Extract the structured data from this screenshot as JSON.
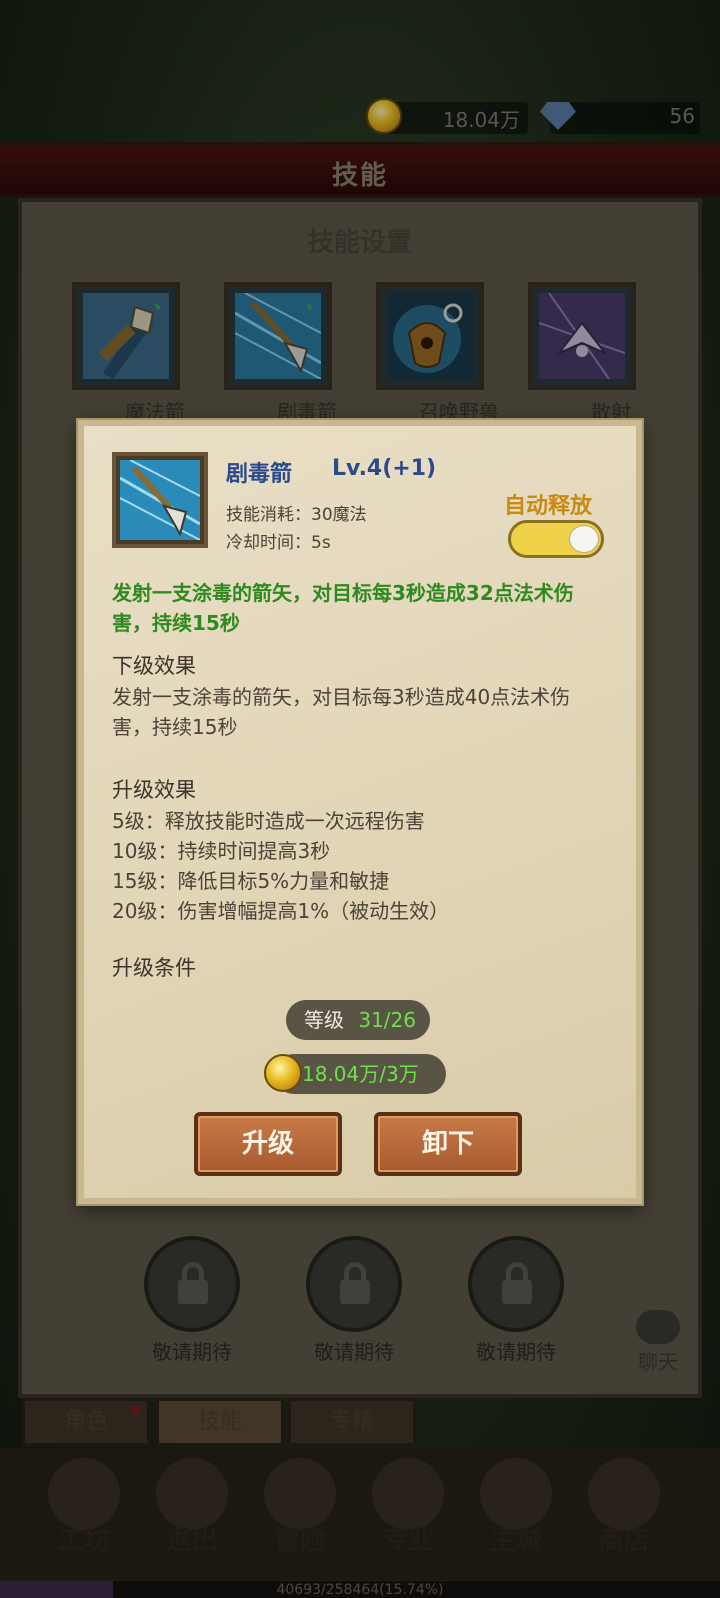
{
  "currency": {
    "gold": "18.04万",
    "gems": "56"
  },
  "window": {
    "title": "技能",
    "settings_title": "技能设置"
  },
  "skill_slots": [
    {
      "name": "魔法箭"
    },
    {
      "name": "剧毒箭"
    },
    {
      "name": "召唤野兽"
    },
    {
      "name": "散射"
    }
  ],
  "locked_slots": [
    {
      "label": "敬请期待"
    },
    {
      "label": "敬请期待"
    },
    {
      "label": "敬请期待"
    }
  ],
  "chat": {
    "label": "聊天"
  },
  "tabs": [
    {
      "label": "角色"
    },
    {
      "label": "技能"
    },
    {
      "label": "专精"
    }
  ],
  "bottom_nav": [
    {
      "label": "工坊"
    },
    {
      "label": "退出"
    },
    {
      "label": "冒险"
    },
    {
      "label": "专业"
    },
    {
      "label": "主城"
    },
    {
      "label": "商店"
    }
  ],
  "exp": {
    "text": "40693/258464(15.74%)",
    "progress": 0.1574
  },
  "popup": {
    "skill_name": "剧毒箭",
    "level": "Lv.4(+1)",
    "cost": "技能消耗：30魔法",
    "cooldown": "冷却时间：5s",
    "auto_label": "自动释放",
    "auto_enabled": true,
    "current_desc": "发射一支涂毒的箭矢，对目标每3秒造成32点法术伤害，持续15秒",
    "next_title": "下级效果",
    "next_desc": "发射一支涂毒的箭矢，对目标每3秒造成40点法术伤害，持续15秒",
    "upgrade_title": "升级效果",
    "upgrade_effects": [
      "5级：释放技能时造成一次远程伤害",
      "10级：持续时间提高3秒",
      "15级：降低目标5%力量和敏捷",
      "20级：伤害增幅提高1%（被动生效）"
    ],
    "req_title": "升级条件",
    "req_level_label": "等级",
    "req_level_value": "31/26",
    "req_gold_value": "18.04万/3万",
    "btn_upgrade": "升级",
    "btn_unequip": "卸下"
  },
  "colors": {
    "skill_name": "#2a4a8a",
    "desc_green": "#2e8a1e",
    "auto_label": "#c88a10",
    "toggle_on": "#f0d24a",
    "req_ok": "#6ee04a"
  }
}
